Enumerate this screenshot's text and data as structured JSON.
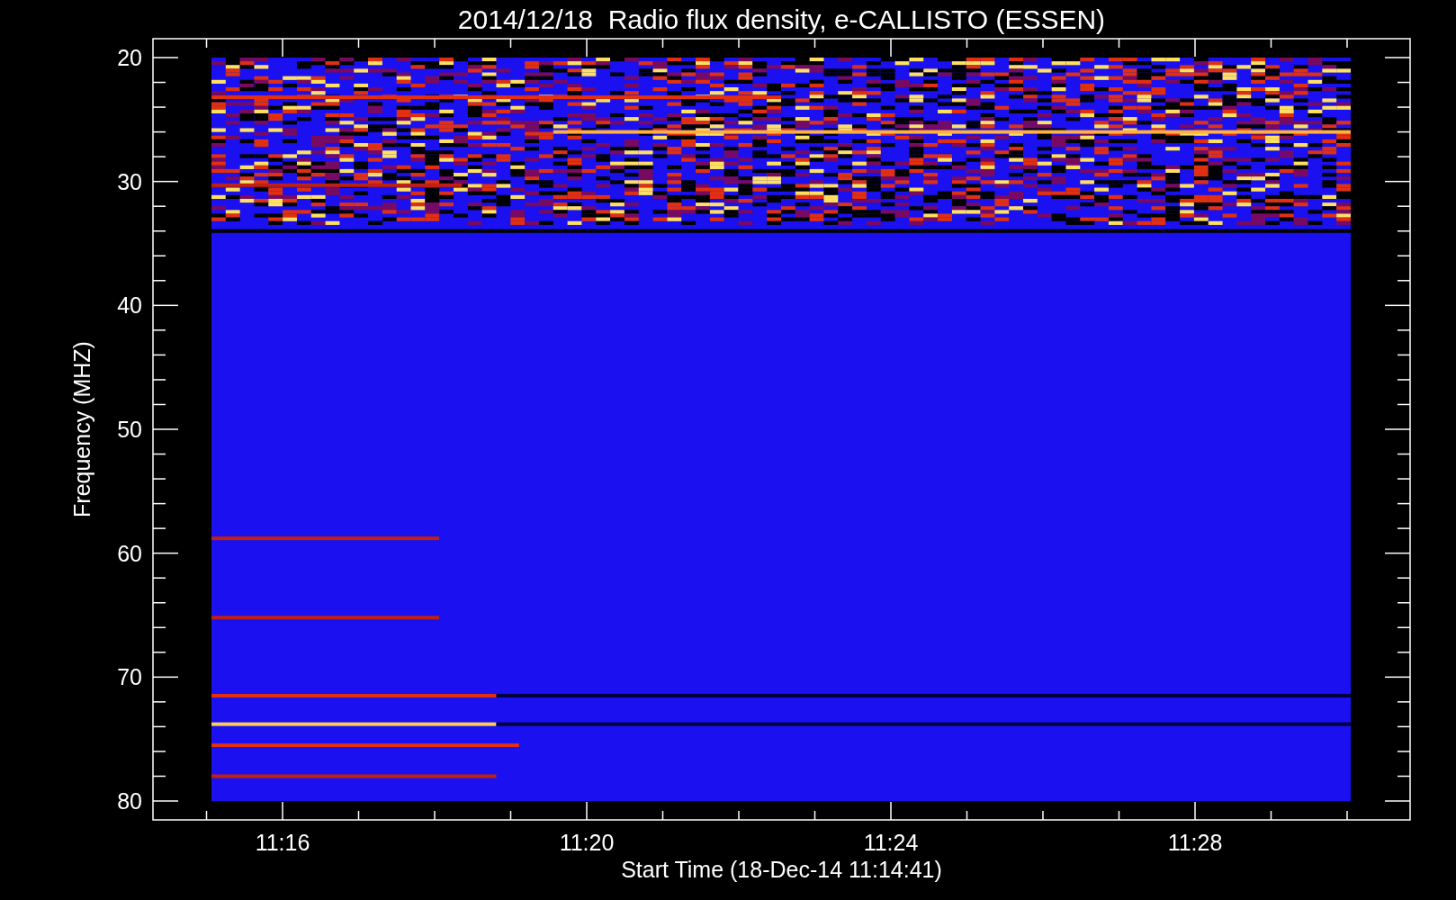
{
  "title": "2014/12/18  Radio flux density, e-CALLISTO (ESSEN)",
  "y_axis": {
    "label": "Frequency (MHZ)",
    "ticks": [
      "20",
      "30",
      "40",
      "50",
      "60",
      "70",
      "80"
    ]
  },
  "x_axis": {
    "label": "Start Time (18-Dec-14 11:14:41)",
    "ticks": [
      "11:16",
      "11:20",
      "11:24",
      "11:28"
    ]
  }
}
